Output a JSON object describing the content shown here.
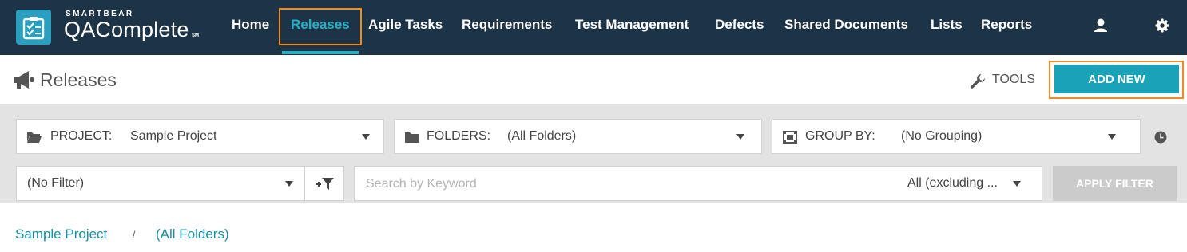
{
  "brand": {
    "company": "SMARTBEAR",
    "product": "QAComplete",
    "trademark": "SM"
  },
  "nav": {
    "items": [
      {
        "label": "Home"
      },
      {
        "label": "Releases",
        "active": true
      },
      {
        "label": "Agile Tasks"
      },
      {
        "label": "Requirements"
      },
      {
        "label": "Test Management"
      },
      {
        "label": "Defects"
      },
      {
        "label": "Shared Documents"
      },
      {
        "label": "Lists"
      },
      {
        "label": "Reports"
      }
    ],
    "icons": [
      "user-icon",
      "gear-icon"
    ]
  },
  "header": {
    "title": "Releases",
    "title_icon": "megaphone-icon",
    "tools_label": "TOOLS",
    "tools_icon": "wrench-icon",
    "add_new_label": "ADD NEW"
  },
  "filters": {
    "project": {
      "label": "PROJECT:",
      "value": "Sample Project",
      "icon": "folder-open-icon"
    },
    "folders": {
      "label": "FOLDERS:",
      "value": "(All Folders)",
      "icon": "folder-icon"
    },
    "group_by": {
      "label": "GROUP BY:",
      "value": "(No Grouping)",
      "icon": "group-icon"
    },
    "history_icon": "clock-icon",
    "filter_select": {
      "value": "(No Filter)"
    },
    "add_filter_icon": "add-filter-icon",
    "search": {
      "placeholder": "Search by Keyword",
      "value": ""
    },
    "scope": {
      "value": "All (excluding ..."
    },
    "apply_label": "APPLY FILTER"
  },
  "breadcrumb": {
    "items": [
      "Sample Project",
      "(All Folders)"
    ],
    "separator": "/"
  },
  "colors": {
    "topbar": "#1d3346",
    "accent": "#29aec6",
    "primary_button": "#19a2b8",
    "highlight": "#f08a24",
    "panel": "#e3e3e3"
  }
}
